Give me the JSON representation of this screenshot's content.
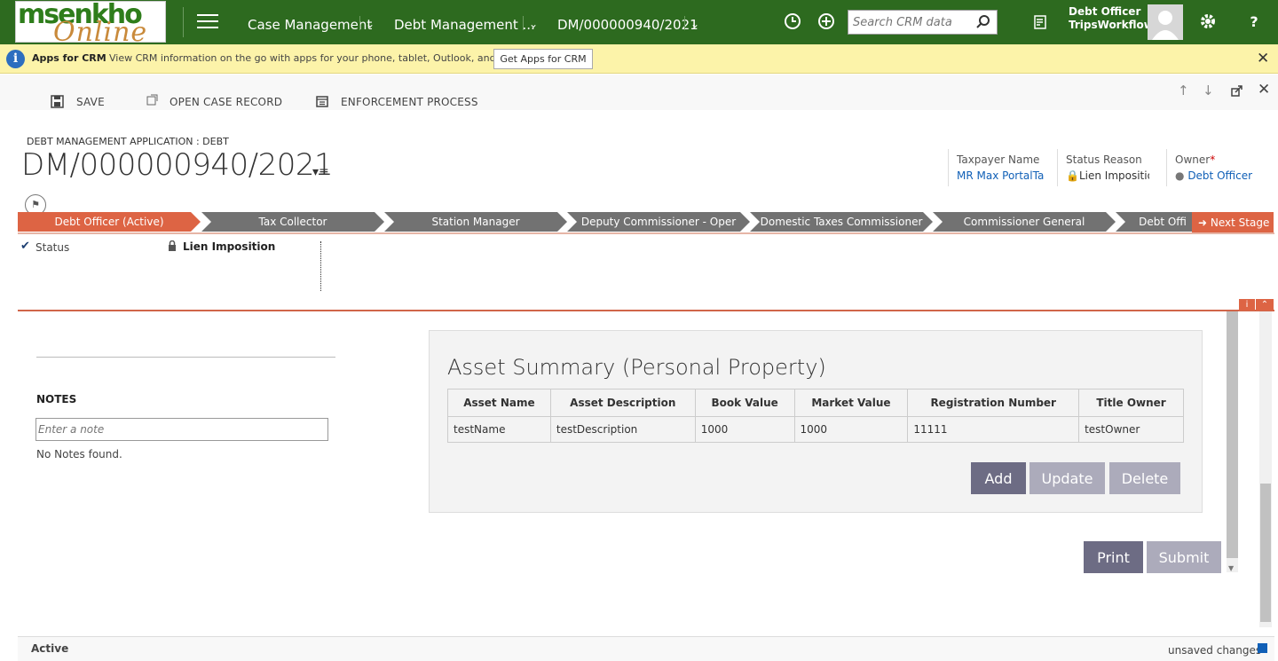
{
  "app": {
    "logo_main": "msenkho",
    "logo_script": "Online",
    "nav": [
      "Case Management",
      "Debt Management ...",
      "DM/000000940/2021"
    ],
    "search_placeholder": "Search CRM data",
    "user_role": "Debt Officer",
    "user_workflow": "TripsWorkflow",
    "help_label": "?"
  },
  "notice": {
    "title": "Apps for CRM",
    "text": "View CRM information on the go with apps for your phone, tablet, Outlook, and more!",
    "button": "Get Apps for CRM"
  },
  "commands": [
    "SAVE",
    "OPEN CASE RECORD",
    "ENFORCEMENT PROCESS"
  ],
  "form": {
    "subtitle": "DEBT MANAGEMENT APPLICATION : DEBT",
    "title": "DM/000000940/2021",
    "header_fields": [
      {
        "label": "Taxpayer Name",
        "value": "MR Max PortalTa"
      },
      {
        "label": "Status Reason",
        "value": "Lien Impositio"
      },
      {
        "label": "Owner",
        "value": "Debt Officer"
      }
    ]
  },
  "process": {
    "stages": [
      "Debt Officer (Active)",
      "Tax Collector",
      "Station Manager",
      "Deputy Commissioner - Oper",
      "Domestic Taxes Commissioner",
      "Commissioner General",
      "Debt Offi"
    ],
    "next_stage": "Next Stage",
    "step_label": "Status",
    "step_value": "Lien Imposition"
  },
  "notes": {
    "heading": "NOTES",
    "placeholder": "Enter a note",
    "empty": "No Notes found."
  },
  "asset": {
    "title": "Asset Summary (Personal Property)",
    "columns": [
      "Asset Name",
      "Asset Description",
      "Book Value",
      "Market Value",
      "Registration Number",
      "Title Owner"
    ],
    "rows": [
      [
        "testName",
        "testDescription",
        "1000",
        "1000",
        "11111",
        "testOwner"
      ]
    ],
    "buttons": {
      "add": "Add",
      "update": "Update",
      "delete": "Delete"
    }
  },
  "actions": {
    "print": "Print",
    "submit": "Submit"
  },
  "statusbar": {
    "status": "Active",
    "unsaved": "unsaved changes"
  },
  "colors": {
    "topbar": "#2d6a1f",
    "stage_active": "#dd6444",
    "stage": "#727272",
    "notice": "#fcf3a9",
    "button_dark": "#6d6c84",
    "button_light": "#acabbb"
  }
}
